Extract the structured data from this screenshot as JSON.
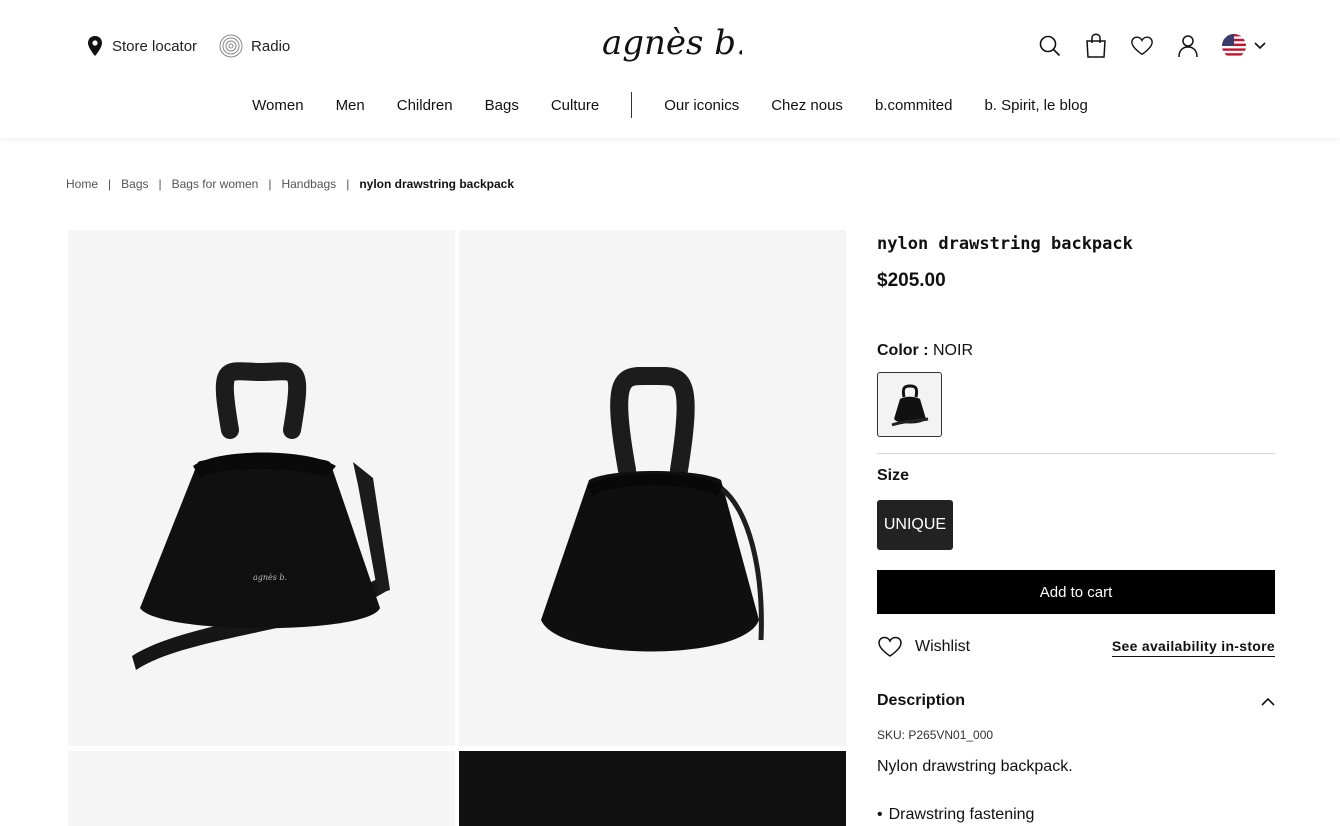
{
  "header": {
    "store_locator": "Store locator",
    "radio": "Radio",
    "brand": "agnès b.",
    "nav": [
      "Women",
      "Men",
      "Children",
      "Bags",
      "Culture"
    ],
    "nav_secondary": [
      "Our iconics",
      "Chez nous",
      "b.commited",
      "b. Spirit, le blog"
    ]
  },
  "breadcrumb": [
    "Home",
    "Bags",
    "Bags for women",
    "Handbags",
    "nylon drawstring backpack"
  ],
  "product": {
    "title": "nylon drawstring backpack",
    "price": "$205.00",
    "color_label": "Color :",
    "color_value": "NOIR",
    "size_label": "Size",
    "size_value": "UNIQUE",
    "add_to_cart": "Add to cart",
    "wishlist": "Wishlist",
    "availability": "See availability in-store",
    "description_title": "Description",
    "sku": "SKU: P265VN01_000",
    "description": "Nylon drawstring backpack.",
    "feature_bullet": "Drawstring fastening"
  },
  "colors": {
    "brand_black": "#000000",
    "page_bg": "#ffffff",
    "gallery_bg": "#f5f5f5"
  }
}
